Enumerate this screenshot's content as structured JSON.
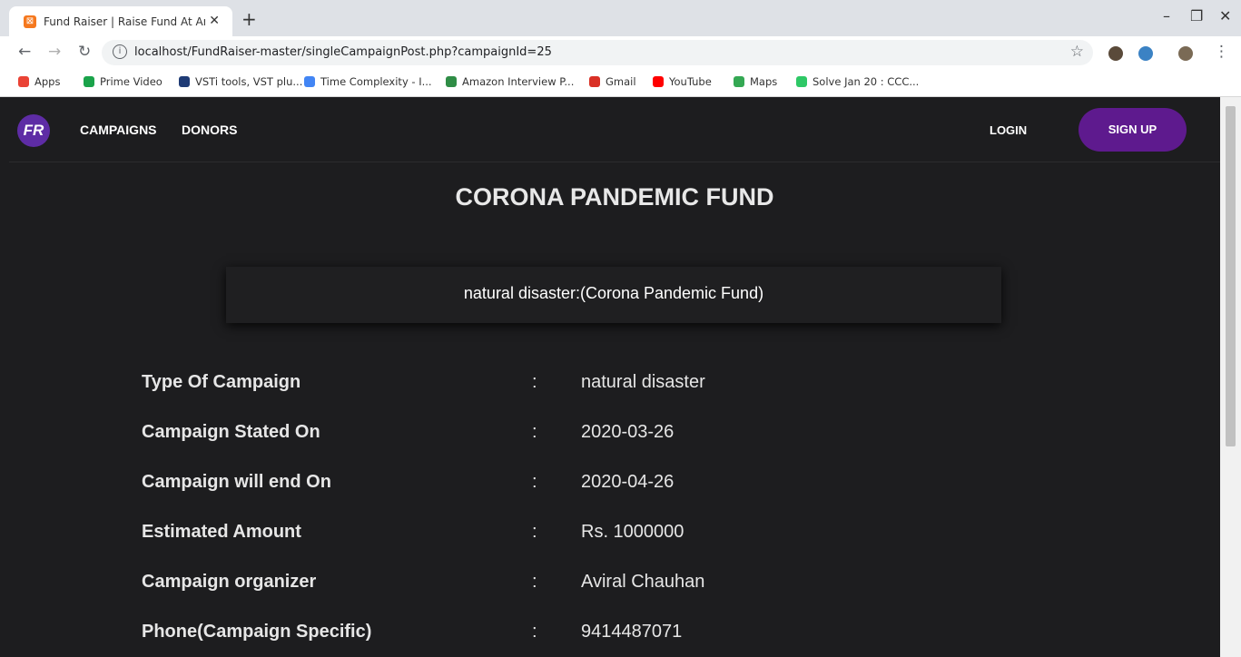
{
  "browser": {
    "tab_title": "Fund Raiser | Raise Fund At An Ea",
    "tab_close": "✕",
    "new_tab": "+",
    "url": "localhost/FundRaiser-master/singleCampaignPost.php?campaignId=25",
    "bookmarks": [
      {
        "label": "Apps",
        "color": "#ea4335"
      },
      {
        "label": "Prime Video",
        "color": "#1aa34a"
      },
      {
        "label": "VSTi tools, VST plu...",
        "color": "#1f3b75"
      },
      {
        "label": "Time Complexity - I...",
        "color": "#4285f4"
      },
      {
        "label": "Amazon Interview P...",
        "color": "#2f8d46"
      },
      {
        "label": "Gmail",
        "color": "#d93025"
      },
      {
        "label": "YouTube",
        "color": "#ff0000"
      },
      {
        "label": "Maps",
        "color": "#34a853"
      },
      {
        "label": "Solve Jan 20 : CCC...",
        "color": "#2ec866"
      }
    ],
    "icons": [
      "back-icon",
      "forward-icon",
      "reload-icon",
      "info-icon",
      "star-icon",
      "minimize-icon",
      "restore-icon",
      "close-icon",
      "menu-icon"
    ]
  },
  "site": {
    "logo": "FR",
    "nav": {
      "campaigns": "CAMPAIGNS",
      "donors": "DONORS",
      "login": "LOGIN",
      "signup": "SIGN UP"
    },
    "accent_color": "#5e1a8e",
    "background_color": "#1d1d1f"
  },
  "campaign": {
    "title": "CORONA PANDEMIC FUND",
    "subtitle": "natural disaster:(Corona Pandemic Fund)",
    "separator": ":",
    "details": [
      {
        "label": "Type Of Campaign",
        "value": "natural disaster"
      },
      {
        "label": "Campaign Stated On",
        "value": "2020-03-26"
      },
      {
        "label": "Campaign will end On",
        "value": "2020-04-26"
      },
      {
        "label": "Estimated Amount",
        "value": "Rs. 1000000"
      },
      {
        "label": "Campaign organizer",
        "value": "Aviral Chauhan"
      },
      {
        "label": "Phone(Campaign Specific)",
        "value": "9414487071"
      }
    ]
  }
}
